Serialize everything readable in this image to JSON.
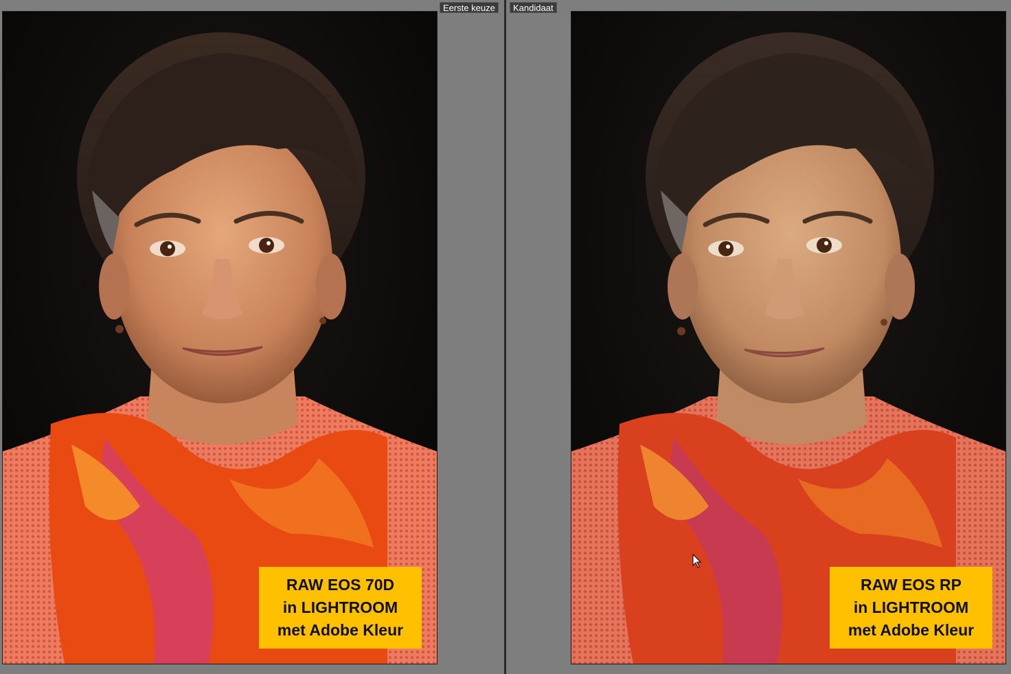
{
  "window": {
    "left_tag": "Eerste keuze",
    "right_tag": "Kandidaat"
  },
  "photos": [
    {
      "label_lines": [
        "RAW EOS 70D",
        "in LIGHTROOM",
        "met Adobe Kleur"
      ]
    },
    {
      "label_lines": [
        "RAW EOS RP",
        "in LIGHTROOM",
        "met Adobe Kleur"
      ]
    }
  ],
  "colors": {
    "background": "#808080",
    "label_bg": "#ffc000",
    "label_text": "#111111",
    "tag_bg": "#3b3b3b"
  },
  "icons": [
    "mouse-cursor-icon"
  ]
}
